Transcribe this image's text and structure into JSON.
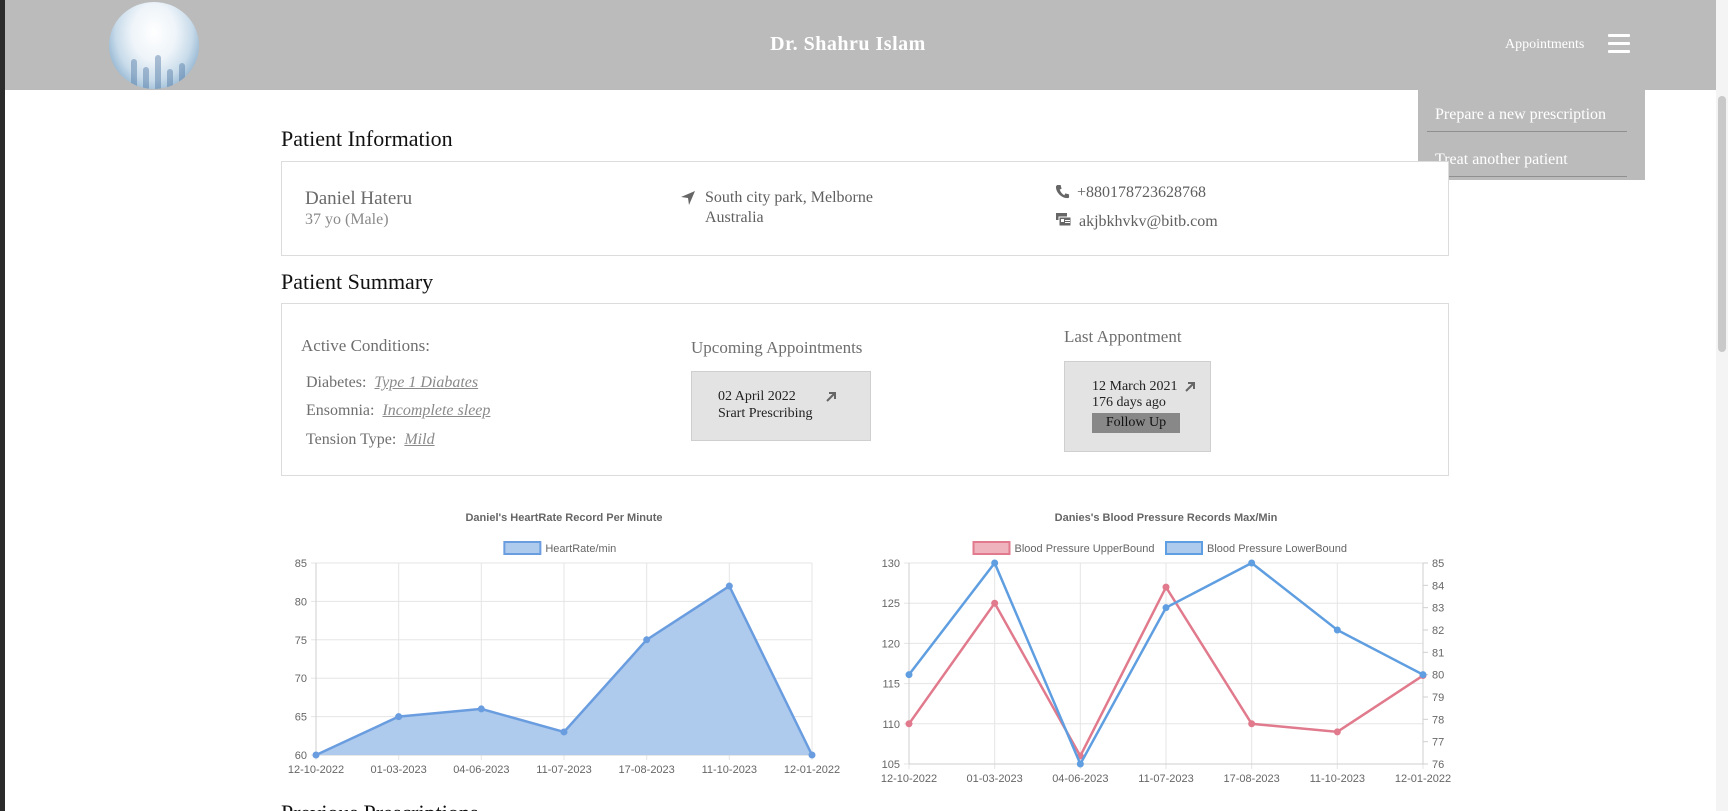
{
  "navbar": {
    "brand": "Dr. Shahru Islam",
    "appointments_label": "Appointments",
    "menu_icon": "hamburger-icon"
  },
  "dropdown": {
    "items": [
      "Prepare a new prescription",
      "Treat another patient"
    ]
  },
  "patient_info": {
    "section_title": "Patient Information",
    "name": "Daniel Hateru",
    "age_gender": "37 yo (Male)",
    "address_line1": "South city park, Melborne",
    "address_line2": "Australia",
    "phone": "+880178723628768",
    "email": "akjbkhvkv@bitb.com",
    "icons": {
      "address": "location-arrow-icon",
      "phone": "phone-icon",
      "email": "id-card-icon"
    }
  },
  "patient_summary": {
    "section_title": "Patient Summary",
    "active_conditions_title": "Active Conditions:",
    "conditions": [
      {
        "label": "Diabetes:",
        "value": "Type 1 Diabates"
      },
      {
        "label": "Ensomnia:",
        "value": "Incomplete sleep"
      },
      {
        "label": "Tension Type:",
        "value": "Mild"
      }
    ],
    "upcoming_title": "Upcoming Appointments",
    "upcoming": {
      "date": "02 April 2022",
      "note": "Srart Prescribing"
    },
    "last_title": "Last Appontment",
    "last": {
      "date": "12 March 2021",
      "ago": "176 days ago",
      "button": "Follow Up"
    }
  },
  "chart_data": [
    {
      "type": "area",
      "title": "Daniel's HeartRate Record Per Minute",
      "categories": [
        "12-10-2022",
        "01-03-2023",
        "04-06-2023",
        "11-07-2023",
        "17-08-2023",
        "11-10-2023",
        "12-01-2022"
      ],
      "series": [
        {
          "name": "HeartRate/min",
          "values": [
            60,
            65,
            66,
            63,
            75,
            82,
            60
          ],
          "color": "#6a9ddf",
          "fill": "#aecaec"
        }
      ],
      "ylim": [
        60,
        85
      ],
      "yticks": [
        60,
        65,
        70,
        75,
        80,
        85
      ],
      "grid": true,
      "legend": "top"
    },
    {
      "type": "line",
      "title": "Danies's Blood Pressure Records Max/Min",
      "categories": [
        "12-10-2022",
        "01-03-2023",
        "04-06-2023",
        "11-07-2023",
        "17-08-2023",
        "11-10-2023",
        "12-01-2022"
      ],
      "series": [
        {
          "name": "Blood Pressure UpperBound",
          "values": [
            110,
            125,
            106,
            127,
            110,
            109,
            116
          ],
          "axis": "left",
          "color": "#e07a8c",
          "fill": "#efb3bd"
        },
        {
          "name": "Blood Pressure LowerBound",
          "values": [
            80,
            85,
            76,
            83,
            85,
            82,
            80
          ],
          "axis": "right",
          "color": "#5f9ee0",
          "fill": "#aecaec"
        }
      ],
      "ylim": [
        105,
        130
      ],
      "yticks": [
        105,
        110,
        115,
        120,
        125,
        130
      ],
      "y2lim": [
        76,
        85
      ],
      "y2ticks": [
        76,
        77,
        78,
        79,
        80,
        81,
        82,
        83,
        84,
        85
      ],
      "grid": true,
      "legend": "top"
    }
  ],
  "bottom_heading": "Previous Prescriptions"
}
